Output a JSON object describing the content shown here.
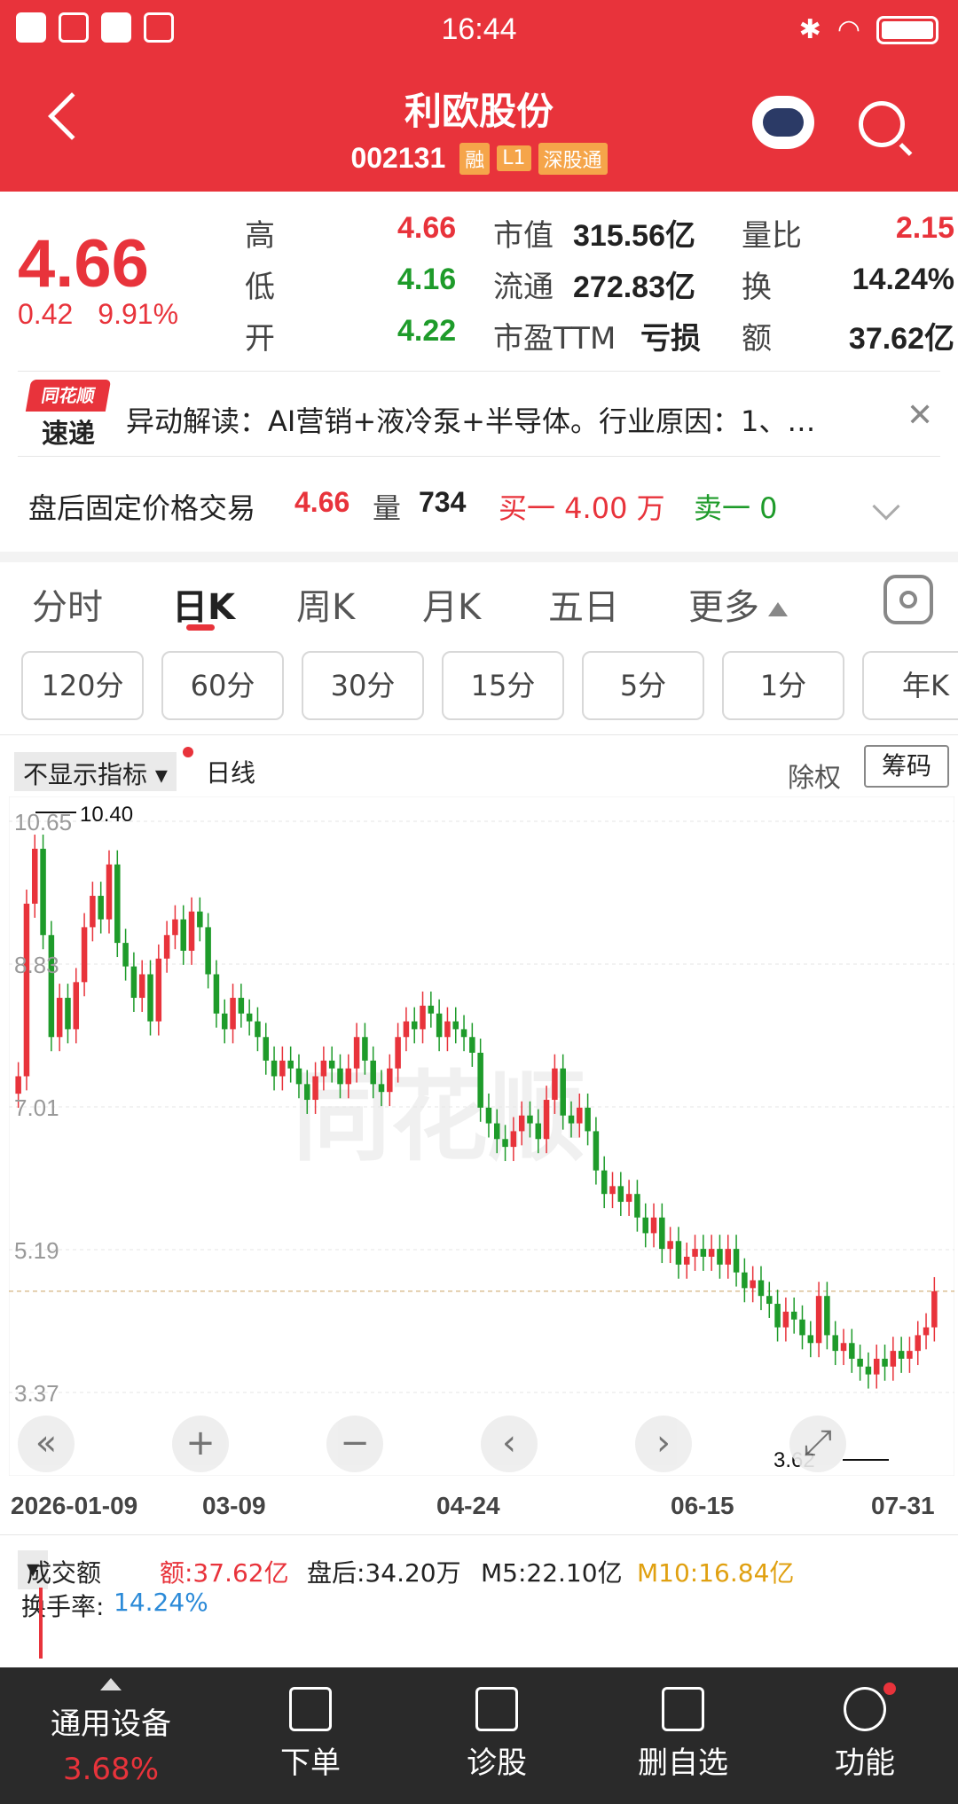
{
  "status": {
    "time": "16:44"
  },
  "header": {
    "title": "利欧股份",
    "code": "002131",
    "tags": [
      "融",
      "L1",
      "深股通"
    ]
  },
  "quote": {
    "price": "4.66",
    "change": "0.42",
    "change_pct": "9.91%",
    "high_label": "高",
    "high": "4.66",
    "low_label": "低",
    "low": "4.16",
    "open_label": "开",
    "open": "4.22",
    "mcap_label": "市值",
    "mcap": "315.56亿",
    "float_label": "流通",
    "float": "272.83亿",
    "pe_label": "市盈TTM",
    "pe": "亏损",
    "vr_label": "量比",
    "vr": "2.15",
    "turnover_label": "换",
    "turnover": "14.24%",
    "amount_label": "额",
    "amount": "37.62亿"
  },
  "news": {
    "logo_top": "同花顺",
    "logo_bottom": "速递",
    "text": "异动解读：AI营销+液冷泵+半导体。行业原因：1、…"
  },
  "after_hours": {
    "label": "盘后固定价格交易",
    "price": "4.66",
    "vol_label": "量",
    "vol": "734",
    "buy": "买一 4.00 万",
    "sell": "卖一 0"
  },
  "tabs": [
    "分时",
    "日K",
    "周K",
    "月K",
    "五日",
    "更多"
  ],
  "periods": [
    "120分",
    "60分",
    "30分",
    "15分",
    "5分",
    "1分",
    "年K"
  ],
  "chart_header": {
    "indicator": "不显示指标",
    "line": "日线",
    "fq": "除权",
    "chip": "筹码"
  },
  "chart_data": {
    "type": "candlestick",
    "y_ticks": [
      "10.65",
      "8.83",
      "7.01",
      "5.19",
      "3.37"
    ],
    "ylim": [
      3.37,
      10.65
    ],
    "x_ticks": [
      "2026-01-09",
      "03-09",
      "04-24",
      "06-15",
      "07-31"
    ],
    "max_label": "10.40",
    "min_label": "3.62",
    "last_close": 4.66,
    "closes": [
      7.4,
      9.6,
      10.3,
      9.2,
      7.9,
      8.4,
      8.0,
      8.6,
      9.3,
      9.7,
      9.4,
      10.1,
      9.1,
      8.8,
      8.4,
      8.7,
      8.1,
      8.9,
      9.2,
      9.4,
      9.0,
      9.5,
      9.3,
      8.7,
      8.2,
      8.0,
      8.4,
      8.2,
      8.1,
      7.9,
      7.6,
      7.4,
      7.6,
      7.5,
      7.3,
      7.1,
      7.4,
      7.6,
      7.5,
      7.3,
      7.5,
      7.9,
      7.6,
      7.3,
      7.2,
      7.5,
      7.9,
      8.1,
      8.0,
      8.3,
      8.2,
      7.9,
      8.1,
      8.0,
      7.9,
      7.7,
      7.0,
      6.8,
      6.6,
      6.5,
      6.7,
      6.9,
      6.8,
      6.6,
      7.1,
      7.5,
      6.9,
      6.8,
      7.0,
      6.7,
      6.2,
      5.9,
      6.0,
      5.8,
      5.9,
      5.6,
      5.4,
      5.6,
      5.2,
      5.3,
      5.0,
      5.1,
      5.2,
      5.1,
      5.2,
      5.0,
      5.2,
      4.9,
      4.7,
      4.8,
      4.6,
      4.5,
      4.2,
      4.4,
      4.3,
      4.1,
      4.0,
      4.6,
      4.1,
      3.9,
      4.0,
      3.8,
      3.7,
      3.6,
      3.8,
      3.7,
      3.9,
      3.8,
      3.9,
      4.1,
      4.2,
      4.66
    ]
  },
  "volume": {
    "selector": "成交额",
    "amount": "额:37.62亿",
    "after": "盘后:34.20万",
    "m5": "M5:22.10亿",
    "m10": "M10:16.84亿",
    "turnover_label": "换手率:",
    "turnover": "14.24%"
  },
  "bottom_bar": {
    "sector": "通用设备",
    "sector_pct": "3.68%",
    "order": "下单",
    "diagnose": "诊股",
    "remove": "删自选",
    "func": "功能"
  },
  "colors": {
    "up": "#e8333b",
    "down": "#1e9b2a",
    "header": "#e8333b"
  }
}
